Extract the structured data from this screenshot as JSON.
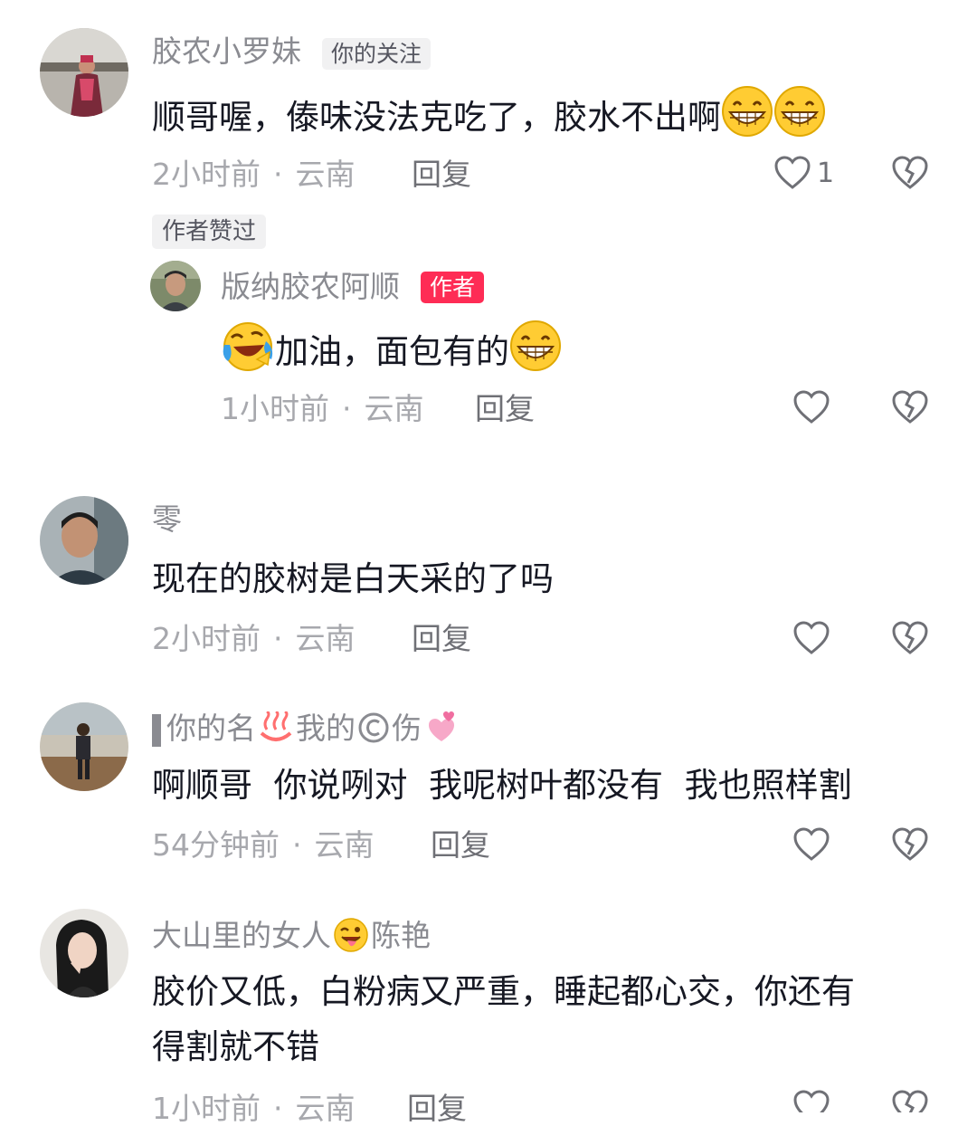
{
  "comments": [
    {
      "username": "胶农小罗妹",
      "tag": "你的关注",
      "text": "顺哥喔，傣味没法克吃了，胶水不出啊",
      "time": "2小时前",
      "location": "云南",
      "reply": "回复",
      "likes": "1",
      "badge": "作者赞过"
    },
    {
      "username": "版纳胶农阿顺",
      "tag": "作者",
      "text": "加油，面包有的",
      "time": "1小时前",
      "location": "云南",
      "reply": "回复"
    },
    {
      "username": "零",
      "text": "现在的胶树是白天采的了吗",
      "time": "2小时前",
      "location": "云南",
      "reply": "回复"
    },
    {
      "username_a": "你的名",
      "username_b": "我的",
      "username_c": "伤",
      "text": "啊顺哥  你说咧对  我呢树叶都没有  我也照样割",
      "time": "54分钟前",
      "location": "云南",
      "reply": "回复"
    },
    {
      "username_a": "大山里的女人",
      "username_b": "陈艳",
      "text_line1": "胶价又低，白粉病又严重，睡起都心交，你还有",
      "text_line2": "得割就不错",
      "time": "1小时前",
      "location": "云南",
      "reply": "回复"
    }
  ],
  "separator": "·",
  "icons": [
    "heart-outline-icon",
    "broken-heart-icon",
    "grin-emoji",
    "laugh-cry-emoji",
    "hot-spring-emoji",
    "copyright-icon",
    "two-hearts-emoji",
    "tongue-wink-emoji"
  ],
  "colors": {
    "author_tag": "#fe2c55",
    "username": "#8a8b91",
    "meta": "#a7a8ad"
  }
}
